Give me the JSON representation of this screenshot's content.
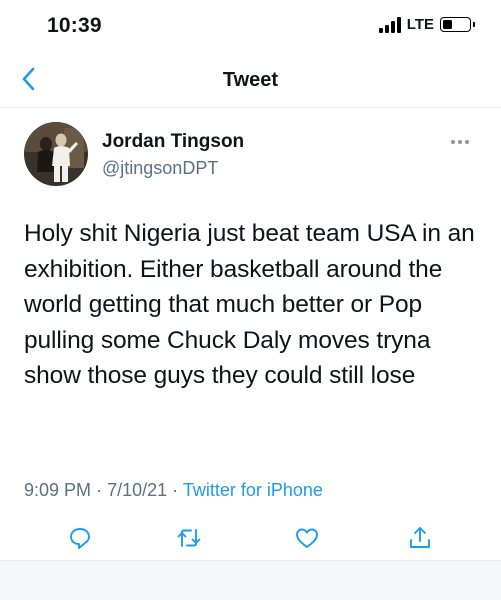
{
  "status_bar": {
    "time": "10:39",
    "network": "LTE",
    "battery_level": 0.3
  },
  "nav": {
    "title": "Tweet",
    "back_icon": "chevron-left-icon"
  },
  "tweet": {
    "author": {
      "display_name": "Jordan Tingson",
      "handle": "@jtingsonDPT"
    },
    "text": "Holy shit Nigeria just beat team USA in an exhibition. Either basketball around the world getting that much better or Pop pulling some Chuck Daly moves tryna show those guys they could still lose",
    "time": "9:09 PM",
    "separator": "·",
    "date": "7/10/21",
    "source": "Twitter for iPhone"
  },
  "actions": [
    "reply-icon",
    "retweet-icon",
    "like-icon",
    "share-icon"
  ],
  "colors": {
    "accent": "#1d9bf0",
    "secondary_text": "#5b7083",
    "divider": "#e6ecf0"
  }
}
